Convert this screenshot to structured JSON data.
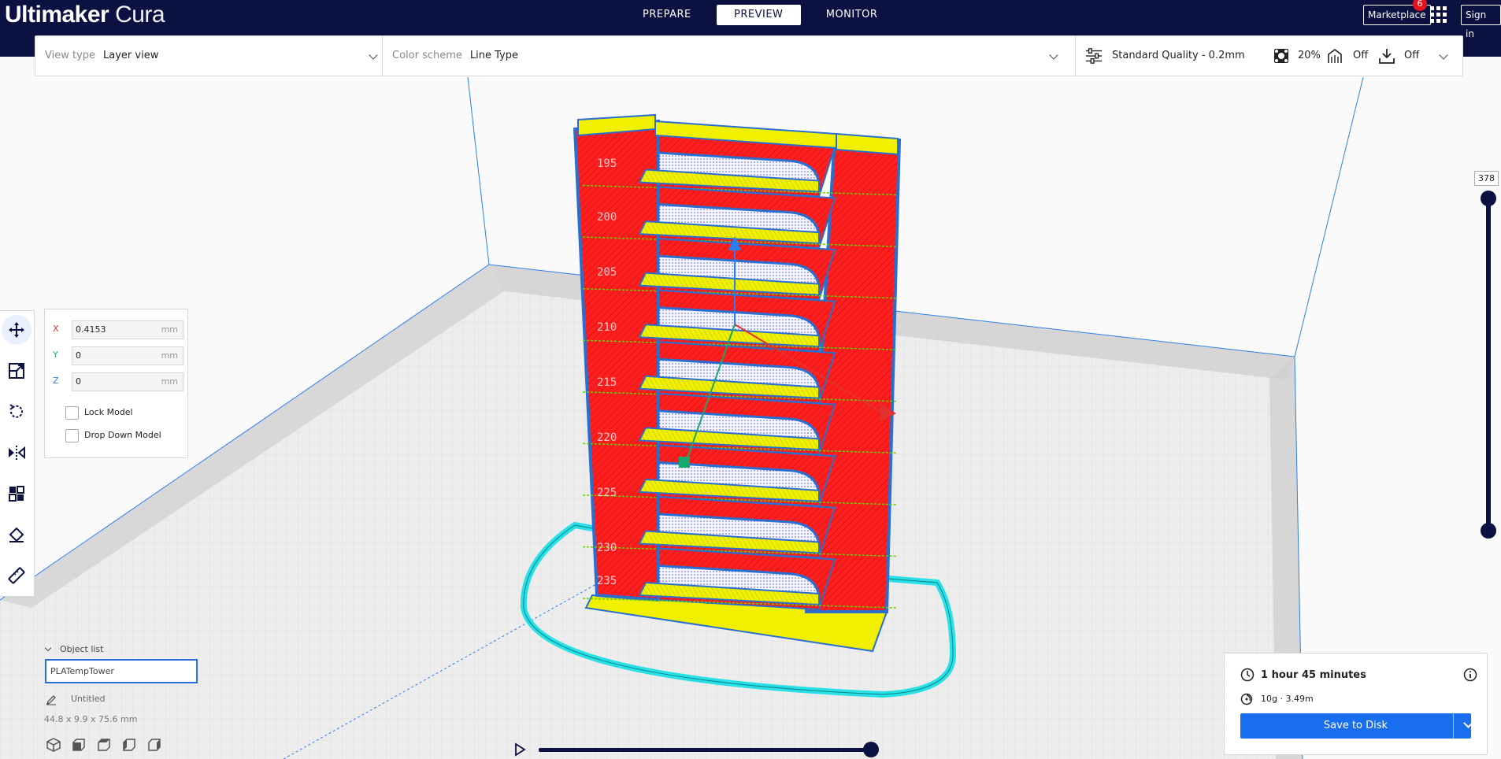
{
  "app": {
    "brand_bold": "Ultimaker",
    "brand_light": "Cura"
  },
  "header": {
    "tabs": [
      {
        "label": "PREPARE"
      },
      {
        "label": "PREVIEW"
      },
      {
        "label": "MONITOR"
      }
    ],
    "active_tab": "PREVIEW",
    "marketplace_label": "Marketplace",
    "marketplace_badge": "6",
    "signin_label": "Sign in"
  },
  "toolbar": {
    "view_type_label": "View type",
    "view_type_value": "Layer view",
    "color_scheme_label": "Color scheme",
    "color_scheme_value": "Line Type",
    "quality": "Standard Quality - 0.2mm",
    "infill": "20%",
    "support": "Off",
    "adhesion": "Off"
  },
  "tools": [
    {
      "name": "move"
    },
    {
      "name": "scale"
    },
    {
      "name": "rotate"
    },
    {
      "name": "mirror"
    },
    {
      "name": "per-model-settings"
    },
    {
      "name": "support-blocker"
    },
    {
      "name": "measure"
    }
  ],
  "move_panel": {
    "x": {
      "label": "X",
      "value": "0.4153",
      "unit": "mm"
    },
    "y": {
      "label": "Y",
      "value": "0",
      "unit": "mm"
    },
    "z": {
      "label": "Z",
      "value": "0",
      "unit": "mm"
    },
    "lock_model": "Lock Model",
    "drop_down_model": "Drop Down Model"
  },
  "object_list": {
    "toggle_label": "Object list",
    "items": [
      "PLATempTower"
    ],
    "project_name": "Untitled",
    "dimensions": "44.8 x 9.9 x 75.6 mm"
  },
  "layer_slider": {
    "value": "378"
  },
  "print_panel": {
    "time": "1 hour 45 minutes",
    "material": "10g · 3.49m",
    "save_label": "Save to Disk"
  },
  "colors": {
    "header_bg": "#0b1140",
    "accent": "#196ef0",
    "wall_red": "#ff1f1f",
    "infill_yellow": "#f0f000",
    "skirt_cyan": "#28e0e6"
  }
}
